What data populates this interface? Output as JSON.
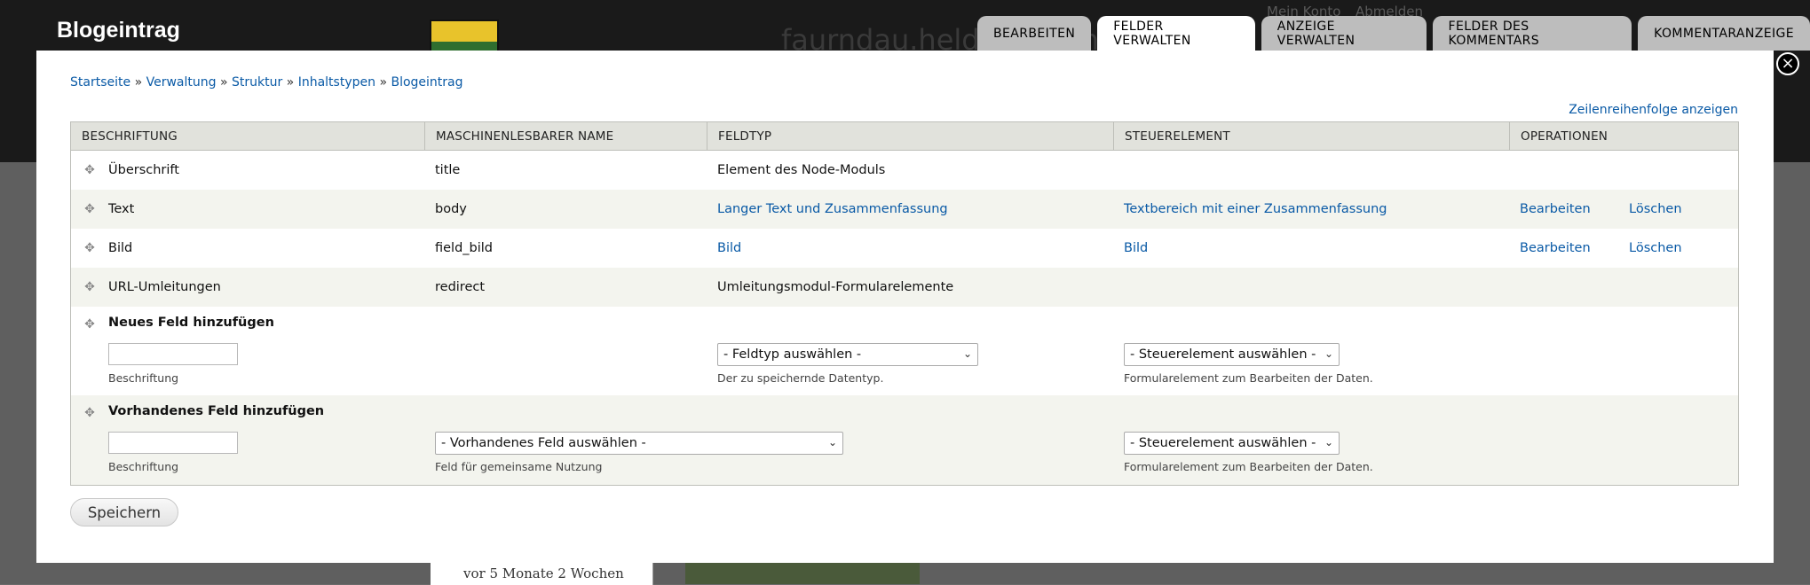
{
  "background": {
    "site_name": "faurndau.heldmaschine",
    "links": [
      "Mein Konto",
      "Abmelden"
    ],
    "sidebar_text": "vor 5 Monate 2 Wochen"
  },
  "overlay": {
    "title": "Blogeintrag",
    "close_label": "×",
    "tabs": [
      {
        "label": "BEARBEITEN"
      },
      {
        "label": "FELDER VERWALTEN"
      },
      {
        "label": "ANZEIGE VERWALTEN"
      },
      {
        "label": "FELDER DES KOMMENTARS"
      },
      {
        "label": "KOMMENTARANZEIGE"
      }
    ]
  },
  "breadcrumb": {
    "items": [
      "Startseite",
      "Verwaltung",
      "Struktur",
      "Inhaltstypen",
      "Blogeintrag"
    ],
    "separator": "»"
  },
  "row_weight_link": "Zeilenreihenfolge anzeigen",
  "table": {
    "headers": [
      "BESCHRIFTUNG",
      "MASCHINENLESBARER NAME",
      "FELDTYP",
      "STEUERELEMENT",
      "OPERATIONEN"
    ],
    "rows": [
      {
        "label": "Überschrift",
        "machine": "title",
        "type": "Element des Node-Moduls",
        "widget": "",
        "edit": "",
        "delete": ""
      },
      {
        "label": "Text",
        "machine": "body",
        "type": "Langer Text und Zusammenfassung",
        "widget": "Textbereich mit einer Zusammenfassung",
        "edit": "Bearbeiten",
        "delete": "Löschen"
      },
      {
        "label": "Bild",
        "machine": "field_bild",
        "type": "Bild",
        "widget": "Bild",
        "edit": "Bearbeiten",
        "delete": "Löschen"
      },
      {
        "label": "URL-Umleitungen",
        "machine": "redirect",
        "type": "Umleitungsmodul-Formularelemente",
        "widget": "",
        "edit": "",
        "delete": ""
      }
    ],
    "new_field": {
      "title": "Neues Feld hinzufügen",
      "label_value": "",
      "label_desc": "Beschriftung",
      "type_select": "- Feldtyp auswählen -",
      "type_desc": "Der zu speichernde Datentyp.",
      "widget_select": "- Steuerelement auswählen -",
      "widget_desc": "Formularelement zum Bearbeiten der Daten."
    },
    "existing_field": {
      "title": "Vorhandenes Feld hinzufügen",
      "label_value": "",
      "label_desc": "Beschriftung",
      "field_select": "- Vorhandenes Feld auswählen -",
      "field_desc": "Feld für gemeinsame Nutzung",
      "widget_select": "- Steuerelement auswählen -",
      "widget_desc": "Formularelement zum Bearbeiten der Daten."
    }
  },
  "save_button": "Speichern"
}
